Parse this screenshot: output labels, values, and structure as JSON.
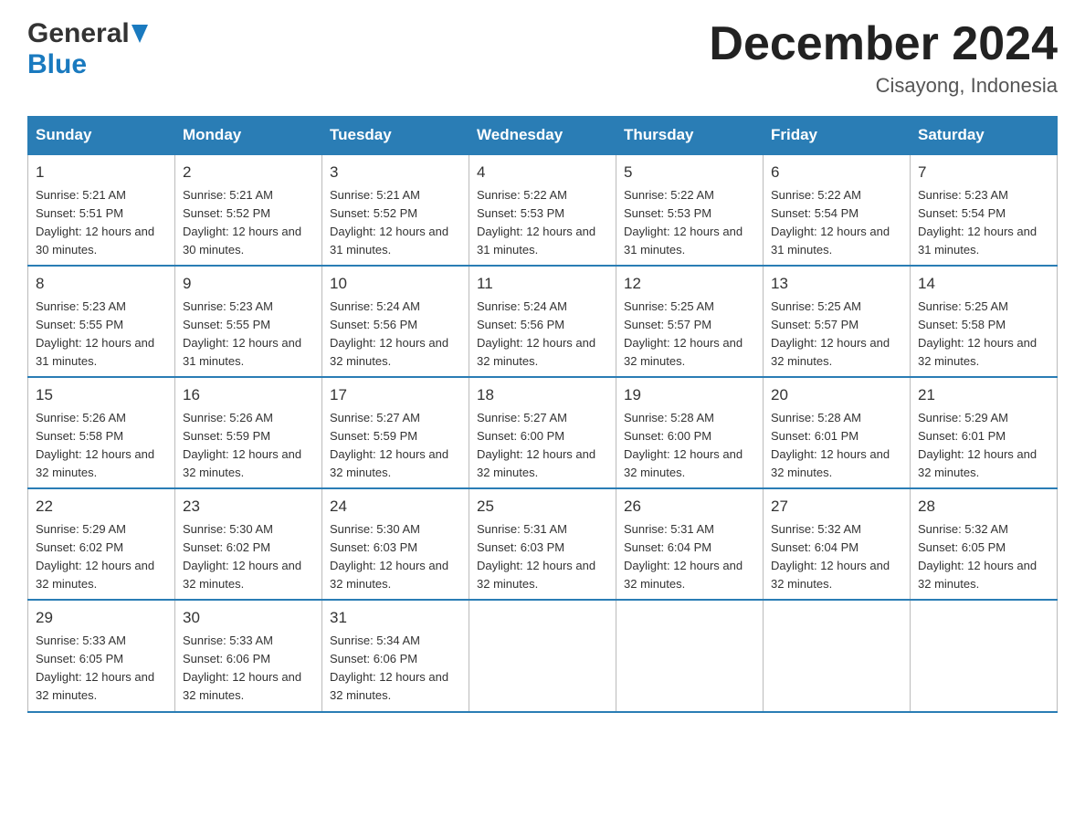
{
  "header": {
    "logo_general": "General",
    "logo_blue": "Blue",
    "month_year": "December 2024",
    "location": "Cisayong, Indonesia"
  },
  "days_of_week": [
    "Sunday",
    "Monday",
    "Tuesday",
    "Wednesday",
    "Thursday",
    "Friday",
    "Saturday"
  ],
  "weeks": [
    [
      {
        "num": "1",
        "sunrise": "5:21 AM",
        "sunset": "5:51 PM",
        "daylight": "12 hours and 30 minutes."
      },
      {
        "num": "2",
        "sunrise": "5:21 AM",
        "sunset": "5:52 PM",
        "daylight": "12 hours and 30 minutes."
      },
      {
        "num": "3",
        "sunrise": "5:21 AM",
        "sunset": "5:52 PM",
        "daylight": "12 hours and 31 minutes."
      },
      {
        "num": "4",
        "sunrise": "5:22 AM",
        "sunset": "5:53 PM",
        "daylight": "12 hours and 31 minutes."
      },
      {
        "num": "5",
        "sunrise": "5:22 AM",
        "sunset": "5:53 PM",
        "daylight": "12 hours and 31 minutes."
      },
      {
        "num": "6",
        "sunrise": "5:22 AM",
        "sunset": "5:54 PM",
        "daylight": "12 hours and 31 minutes."
      },
      {
        "num": "7",
        "sunrise": "5:23 AM",
        "sunset": "5:54 PM",
        "daylight": "12 hours and 31 minutes."
      }
    ],
    [
      {
        "num": "8",
        "sunrise": "5:23 AM",
        "sunset": "5:55 PM",
        "daylight": "12 hours and 31 minutes."
      },
      {
        "num": "9",
        "sunrise": "5:23 AM",
        "sunset": "5:55 PM",
        "daylight": "12 hours and 31 minutes."
      },
      {
        "num": "10",
        "sunrise": "5:24 AM",
        "sunset": "5:56 PM",
        "daylight": "12 hours and 32 minutes."
      },
      {
        "num": "11",
        "sunrise": "5:24 AM",
        "sunset": "5:56 PM",
        "daylight": "12 hours and 32 minutes."
      },
      {
        "num": "12",
        "sunrise": "5:25 AM",
        "sunset": "5:57 PM",
        "daylight": "12 hours and 32 minutes."
      },
      {
        "num": "13",
        "sunrise": "5:25 AM",
        "sunset": "5:57 PM",
        "daylight": "12 hours and 32 minutes."
      },
      {
        "num": "14",
        "sunrise": "5:25 AM",
        "sunset": "5:58 PM",
        "daylight": "12 hours and 32 minutes."
      }
    ],
    [
      {
        "num": "15",
        "sunrise": "5:26 AM",
        "sunset": "5:58 PM",
        "daylight": "12 hours and 32 minutes."
      },
      {
        "num": "16",
        "sunrise": "5:26 AM",
        "sunset": "5:59 PM",
        "daylight": "12 hours and 32 minutes."
      },
      {
        "num": "17",
        "sunrise": "5:27 AM",
        "sunset": "5:59 PM",
        "daylight": "12 hours and 32 minutes."
      },
      {
        "num": "18",
        "sunrise": "5:27 AM",
        "sunset": "6:00 PM",
        "daylight": "12 hours and 32 minutes."
      },
      {
        "num": "19",
        "sunrise": "5:28 AM",
        "sunset": "6:00 PM",
        "daylight": "12 hours and 32 minutes."
      },
      {
        "num": "20",
        "sunrise": "5:28 AM",
        "sunset": "6:01 PM",
        "daylight": "12 hours and 32 minutes."
      },
      {
        "num": "21",
        "sunrise": "5:29 AM",
        "sunset": "6:01 PM",
        "daylight": "12 hours and 32 minutes."
      }
    ],
    [
      {
        "num": "22",
        "sunrise": "5:29 AM",
        "sunset": "6:02 PM",
        "daylight": "12 hours and 32 minutes."
      },
      {
        "num": "23",
        "sunrise": "5:30 AM",
        "sunset": "6:02 PM",
        "daylight": "12 hours and 32 minutes."
      },
      {
        "num": "24",
        "sunrise": "5:30 AM",
        "sunset": "6:03 PM",
        "daylight": "12 hours and 32 minutes."
      },
      {
        "num": "25",
        "sunrise": "5:31 AM",
        "sunset": "6:03 PM",
        "daylight": "12 hours and 32 minutes."
      },
      {
        "num": "26",
        "sunrise": "5:31 AM",
        "sunset": "6:04 PM",
        "daylight": "12 hours and 32 minutes."
      },
      {
        "num": "27",
        "sunrise": "5:32 AM",
        "sunset": "6:04 PM",
        "daylight": "12 hours and 32 minutes."
      },
      {
        "num": "28",
        "sunrise": "5:32 AM",
        "sunset": "6:05 PM",
        "daylight": "12 hours and 32 minutes."
      }
    ],
    [
      {
        "num": "29",
        "sunrise": "5:33 AM",
        "sunset": "6:05 PM",
        "daylight": "12 hours and 32 minutes."
      },
      {
        "num": "30",
        "sunrise": "5:33 AM",
        "sunset": "6:06 PM",
        "daylight": "12 hours and 32 minutes."
      },
      {
        "num": "31",
        "sunrise": "5:34 AM",
        "sunset": "6:06 PM",
        "daylight": "12 hours and 32 minutes."
      },
      null,
      null,
      null,
      null
    ]
  ],
  "labels": {
    "sunrise_prefix": "Sunrise: ",
    "sunset_prefix": "Sunset: ",
    "daylight_prefix": "Daylight: "
  }
}
